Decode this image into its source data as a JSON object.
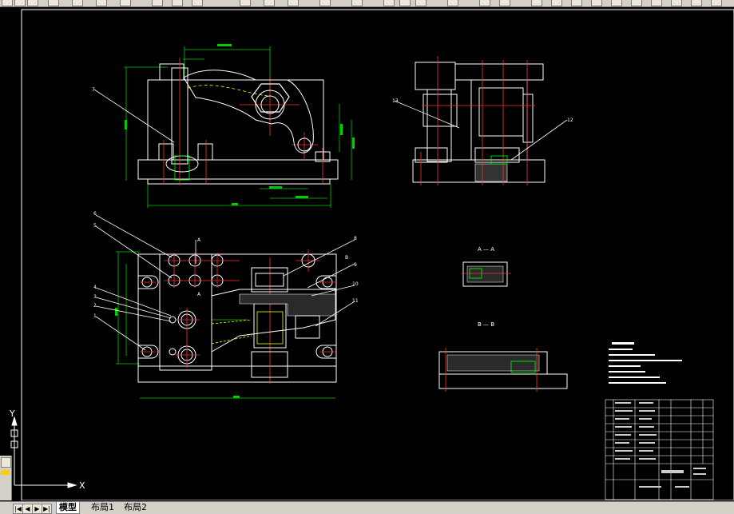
{
  "ucs": {
    "x_label": "X",
    "y_label": "Y"
  },
  "tabs": [
    {
      "label": "模型",
      "active": true
    },
    {
      "label": "布局1",
      "active": false
    },
    {
      "label": "布局2",
      "active": false
    }
  ],
  "nav_buttons": [
    "◀",
    "▶",
    "▶|"
  ],
  "section_labels": {
    "section_a": "A — A",
    "section_b": "B — B"
  },
  "part_numbers": [
    "1",
    "2",
    "3",
    "4",
    "5",
    "6",
    "7",
    "8",
    "9",
    "10",
    "11",
    "12",
    "13"
  ],
  "colors": {
    "background": "#000000",
    "frame": "#ffffff",
    "dimension": "#00ff00",
    "center_line": "#ff0000",
    "hidden": "#ffff00"
  }
}
